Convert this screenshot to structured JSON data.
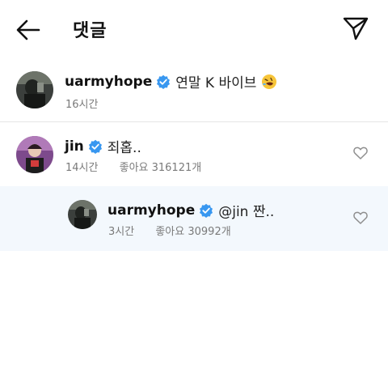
{
  "header": {
    "title": "댓글",
    "back_icon": "arrow-left-icon",
    "share_icon": "paper-plane-icon"
  },
  "caption": {
    "username": "uarmyhope",
    "text": "연말 K 바이브",
    "emoji": "rolling-on-floor-laughing-emoji",
    "time": "16시간"
  },
  "comments": [
    {
      "username": "jin",
      "text": "죄홉..",
      "time": "14시간",
      "likes": "좋아요 316121개"
    },
    {
      "username": "uarmyhope",
      "text": "@jin 짠..",
      "time": "3시간",
      "likes": "좋아요 30992개"
    }
  ],
  "colors": {
    "verified": "#3897f0",
    "reply_highlight": "#f3f8fd",
    "meta_text": "#7a7a7a"
  }
}
